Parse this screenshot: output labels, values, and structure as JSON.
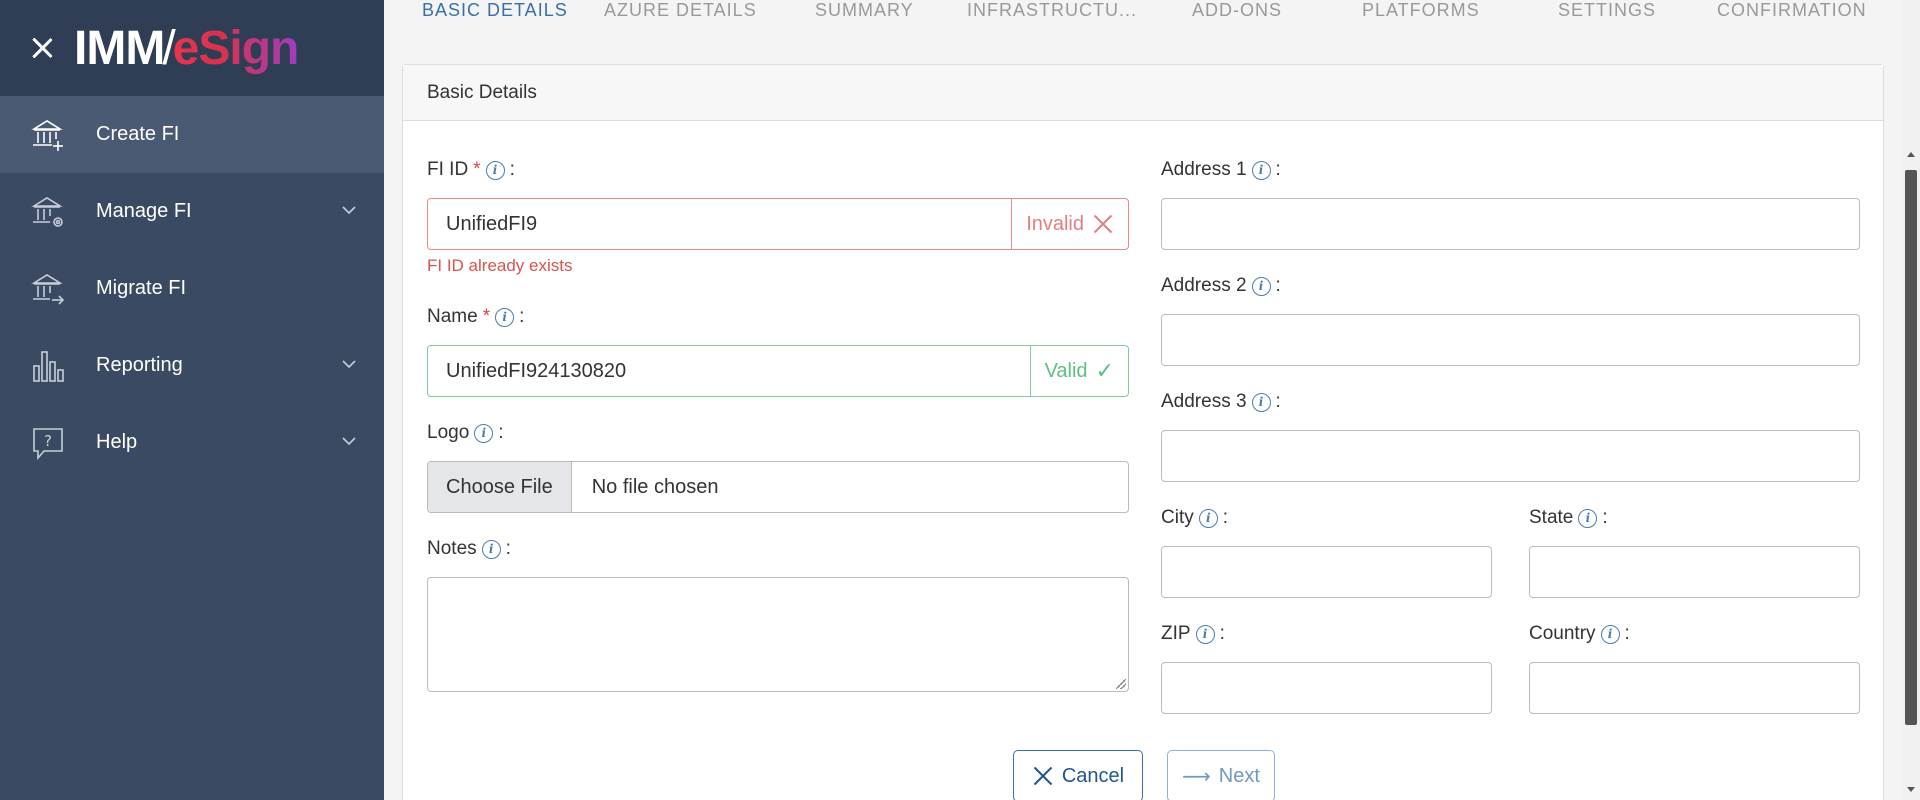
{
  "sidebar": {
    "logo_imm": "IMM",
    "logo_slash": "/",
    "logo_esign": "eSign",
    "items": [
      {
        "label": "Create FI",
        "icon": "bank-add-icon",
        "active": true,
        "expandable": false
      },
      {
        "label": "Manage FI",
        "icon": "bank-gear-icon",
        "active": false,
        "expandable": true
      },
      {
        "label": "Migrate FI",
        "icon": "bank-arrow-icon",
        "active": false,
        "expandable": false
      },
      {
        "label": "Reporting",
        "icon": "bar-chart-icon",
        "active": false,
        "expandable": true
      },
      {
        "label": "Help",
        "icon": "help-bubble-icon",
        "active": false,
        "expandable": true
      }
    ]
  },
  "tabs": [
    "BASIC DETAILS",
    "AZURE DETAILS",
    "SUMMARY",
    "INFRASTRUCTU...",
    "ADD-ONS",
    "PLATFORMS",
    "SETTINGS",
    "CONFIRMATION"
  ],
  "card": {
    "title": "Basic Details"
  },
  "form": {
    "fi_id": {
      "label": "FI ID",
      "required": "*",
      "value": "UnifiedFI9",
      "status": "Invalid",
      "error": "FI ID already exists"
    },
    "name": {
      "label": "Name",
      "required": "*",
      "value": "UnifiedFI924130820",
      "status": "Valid"
    },
    "logo": {
      "label": "Logo",
      "button": "Choose File",
      "file_text": "No file chosen"
    },
    "notes": {
      "label": "Notes",
      "value": ""
    },
    "address1": {
      "label": "Address 1",
      "value": ""
    },
    "address2": {
      "label": "Address 2",
      "value": ""
    },
    "address3": {
      "label": "Address 3",
      "value": ""
    },
    "city": {
      "label": "City",
      "value": ""
    },
    "state": {
      "label": "State",
      "value": ""
    },
    "zip": {
      "label": "ZIP",
      "value": ""
    },
    "country": {
      "label": "Country",
      "value": ""
    },
    "info_glyph": "i",
    "colon": ":"
  },
  "buttons": {
    "cancel": "Cancel",
    "next": "Next"
  },
  "colors": {
    "sidebar_bg": "#3a4a63",
    "sidebar_header": "#2f3d55",
    "accent": "#3a6fa8",
    "invalid": "#e47f7f",
    "valid": "#5fbf82"
  }
}
